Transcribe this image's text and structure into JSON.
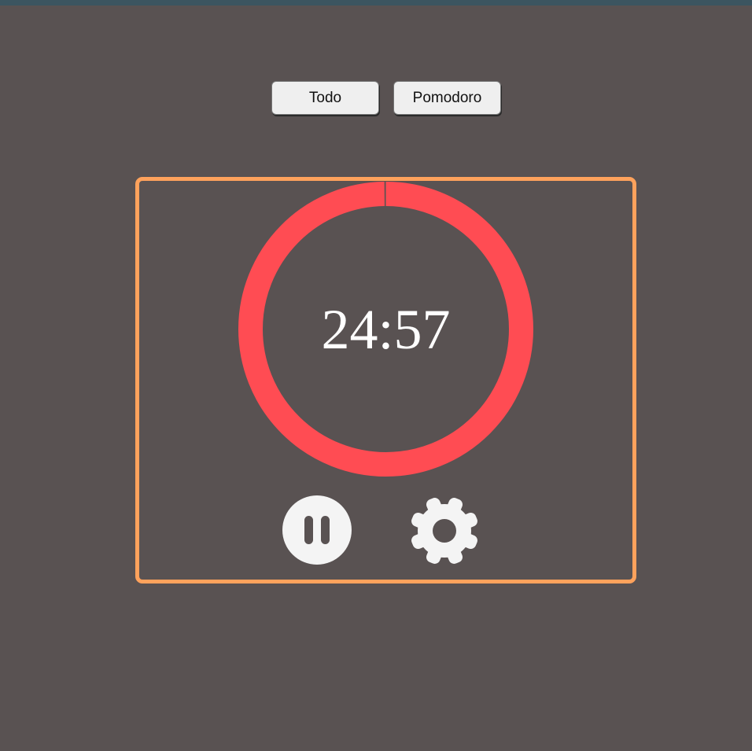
{
  "nav": {
    "todo_label": "Todo",
    "pomodoro_label": "Pomodoro"
  },
  "timer": {
    "display": "24:57",
    "progress": 0.998
  },
  "controls": {
    "pause_icon": "pause-icon",
    "settings_icon": "gear-icon"
  },
  "colors": {
    "background": "#595252",
    "panel_border": "#ffa25c",
    "ring": "#ff4c53",
    "text": "#ffffff",
    "icon": "#f4f4f4"
  }
}
